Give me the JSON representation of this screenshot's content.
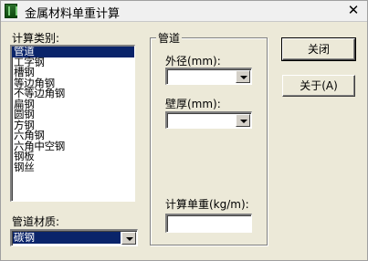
{
  "window": {
    "title": "金属材料单重计算",
    "close_glyph": "✕"
  },
  "material_list": {
    "label": "计算类别:",
    "items": [
      "管道",
      "工字钢",
      "槽钢",
      "等边角钢",
      "不等边角钢",
      "扁钢",
      "圆钢",
      "方钢",
      "六角钢",
      "六角中空钢",
      "钢板",
      "钢丝"
    ],
    "selected_index": 0
  },
  "pipe_material": {
    "label": "管道材质:",
    "value": "碳钢"
  },
  "pipe_group": {
    "title": "管道",
    "outer_diameter_label": "外径(mm):",
    "outer_diameter_value": "",
    "wall_thickness_label": "壁厚(mm):",
    "wall_thickness_value": "",
    "unit_weight_label": "计算单重(kg/m):",
    "unit_weight_value": ""
  },
  "buttons": {
    "close_label": "关闭",
    "about_label": "关于(A)"
  }
}
